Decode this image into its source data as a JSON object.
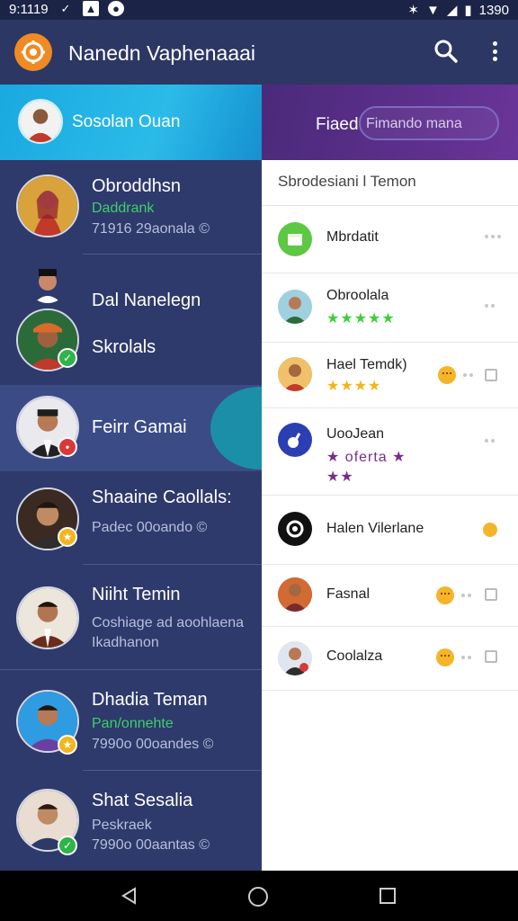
{
  "status_bar": {
    "time": "9:1119",
    "right_time": "1390"
  },
  "app_bar": {
    "title": "Nanedn Vaphenaaai"
  },
  "left_header": {
    "name": "Sosolan Ouan"
  },
  "right_top": {
    "label": "Fiaed",
    "pill_text": "Fimando mana"
  },
  "contacts": [
    {
      "name": "Obroddhsn",
      "sub": "Daddrank",
      "sub_color": "#3ecf6b",
      "meta": "71916 29aonala ©"
    },
    {
      "name": "Dal Nanelegn",
      "name2": "Skrolals"
    },
    {
      "name": "Feirr Gamai"
    },
    {
      "name": "Shaaine Caollals:",
      "sub": "Padec 00oando ©"
    },
    {
      "name": "Niiht Temin",
      "sub": "Coshiage ad aoohlaena",
      "sub2": "Ikadhanon"
    },
    {
      "name": "Dhadia Teman",
      "sub": "Pan/onnehte",
      "sub_color": "#3ecf6b",
      "meta": "7990o 00oandes ©"
    },
    {
      "name": "Shat Sesalia",
      "sub": "Peskraek",
      "meta": "7990o 00aantas ©"
    }
  ],
  "right_panel": {
    "heading": "Sbrodesiani l Temon",
    "items": [
      {
        "name": "Mbrdatit"
      },
      {
        "name": "Obroolala",
        "stars": "★★★★★"
      },
      {
        "name": "Hael Temdk)",
        "stars": "★★★★"
      },
      {
        "name": "UooJean",
        "stars": "★ oferta ★",
        "stars2": "★★"
      },
      {
        "name": "Halen Vilerlane"
      },
      {
        "name": "Fasnal"
      },
      {
        "name": "Coolalza"
      }
    ]
  },
  "colors": {
    "accent_green": "#3ecf6b",
    "star_green": "#3ecf3a",
    "star_yellow": "#f2b51d",
    "star_purple": "#7b2c8c"
  }
}
